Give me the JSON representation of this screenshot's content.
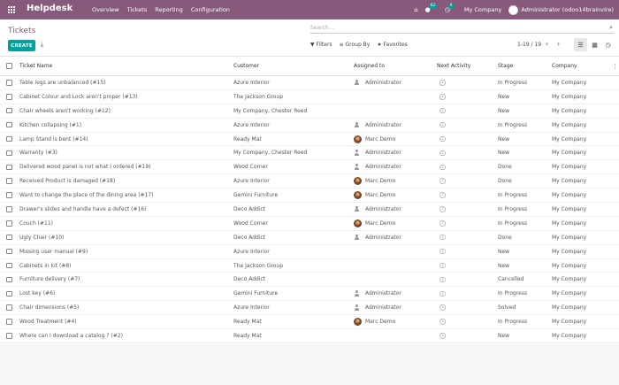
{
  "navbar": {
    "brand": "Helpdesk",
    "menu": [
      "Overview",
      "Tickets",
      "Reporting",
      "Configuration"
    ],
    "chat_badge": "62",
    "activity_badge": "4",
    "company": "My Company",
    "user": "Administrator (odoo14brainvire)",
    "color": "#875a7b"
  },
  "control_panel": {
    "breadcrumb": "Tickets",
    "search_placeholder": "Search...",
    "create_label": "CREATE",
    "filters_label": "Filters",
    "group_by_label": "Group By",
    "favorites_label": "Favorites",
    "pager": "1-19 / 19",
    "accent": "#00a09d"
  },
  "columns": [
    "Ticket Name",
    "Customer",
    "Assigned to",
    "Next Activity",
    "Stage",
    "Company"
  ],
  "rows": [
    {
      "name": "Table legs are unbalanced (#15)",
      "customer": "Azure Interior",
      "assigned": "Administrator",
      "assigned_type": "admin",
      "stage": "In Progress",
      "company": "My Company"
    },
    {
      "name": "Cabinet Colour and Lock aren't proper (#13)",
      "customer": "The Jackson Group",
      "assigned": "",
      "assigned_type": "none",
      "stage": "New",
      "company": "My Company"
    },
    {
      "name": "Chair wheels aren't working (#12)",
      "customer": "My Company, Chester Reed",
      "assigned": "",
      "assigned_type": "none",
      "stage": "New",
      "company": "My Company"
    },
    {
      "name": "Kitchen collapsing (#1)",
      "customer": "Azure Interior",
      "assigned": "Administrator",
      "assigned_type": "admin",
      "stage": "In Progress",
      "company": "My Company"
    },
    {
      "name": "Lamp Stand is bent (#14)",
      "customer": "Ready Mat",
      "assigned": "Marc Demo",
      "assigned_type": "marc",
      "stage": "New",
      "company": "My Company"
    },
    {
      "name": "Warranty (#3)",
      "customer": "My Company, Chester Reed",
      "assigned": "Administrator",
      "assigned_type": "admin",
      "stage": "New",
      "company": "My Company"
    },
    {
      "name": "Delivered wood panel is not what I ordered (#19)",
      "customer": "Wood Corner",
      "assigned": "Administrator",
      "assigned_type": "admin",
      "stage": "Done",
      "company": "My Company"
    },
    {
      "name": "Received Product is damaged (#18)",
      "customer": "Azure Interior",
      "assigned": "Marc Demo",
      "assigned_type": "marc",
      "stage": "Done",
      "company": "My Company"
    },
    {
      "name": "Want to change the place of the dining area (#17)",
      "customer": "Gemini Furniture",
      "assigned": "Marc Demo",
      "assigned_type": "marc",
      "stage": "In Progress",
      "company": "My Company"
    },
    {
      "name": "Drawer's slides and handle have a defect (#16)",
      "customer": "Deco Addict",
      "assigned": "Administrator",
      "assigned_type": "admin",
      "stage": "In Progress",
      "company": "My Company"
    },
    {
      "name": "Couch (#11)",
      "customer": "Wood Corner",
      "assigned": "Marc Demo",
      "assigned_type": "marc",
      "stage": "In Progress",
      "company": "My Company"
    },
    {
      "name": "Ugly Chair (#10)",
      "customer": "Deco Addict",
      "assigned": "Administrator",
      "assigned_type": "admin",
      "stage": "Done",
      "company": "My Company"
    },
    {
      "name": "Missing user manual (#9)",
      "customer": "Azure Interior",
      "assigned": "",
      "assigned_type": "none",
      "stage": "New",
      "company": "My Company"
    },
    {
      "name": "Cabinets in kit (#8)",
      "customer": "The Jackson Group",
      "assigned": "",
      "assigned_type": "none",
      "stage": "New",
      "company": "My Company"
    },
    {
      "name": "Furniture delivery (#7)",
      "customer": "Deco Addict",
      "assigned": "",
      "assigned_type": "none",
      "stage": "Cancelled",
      "company": "My Company"
    },
    {
      "name": "Lost key (#6)",
      "customer": "Gemini Furniture",
      "assigned": "Administrator",
      "assigned_type": "admin",
      "stage": "In Progress",
      "company": "My Company"
    },
    {
      "name": "Chair dimensions (#5)",
      "customer": "Azure Interior",
      "assigned": "Administrator",
      "assigned_type": "admin",
      "stage": "Solved",
      "company": "My Company"
    },
    {
      "name": "Wood Treatment (#4)",
      "customer": "Ready Mat",
      "assigned": "Marc Demo",
      "assigned_type": "marc",
      "stage": "In Progress",
      "company": "My Company"
    },
    {
      "name": "Where can I download a catalog ? (#2)",
      "customer": "Ready Mat",
      "assigned": "",
      "assigned_type": "none",
      "stage": "New",
      "company": "My Company"
    }
  ]
}
